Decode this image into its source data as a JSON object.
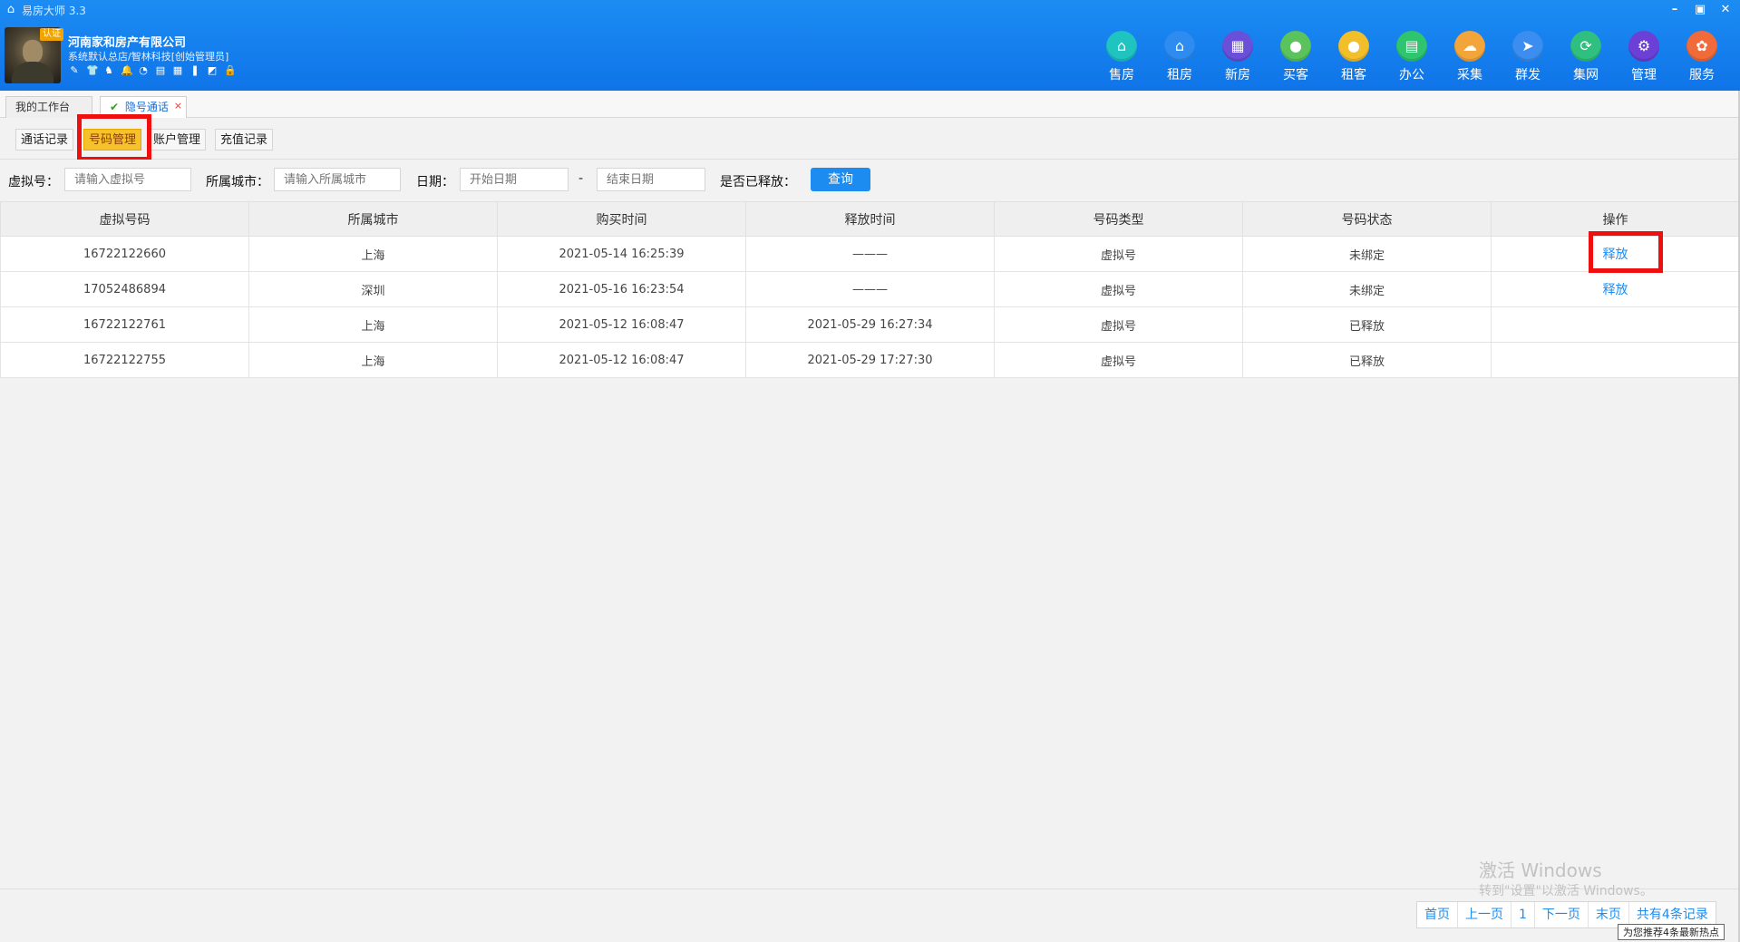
{
  "app": {
    "title": "易房大师 3.3",
    "controls": [
      "–",
      "▣",
      "✕"
    ]
  },
  "profile": {
    "badge": "认证",
    "company": "河南家和房产有限公司",
    "subtitle": "系统默认总店/智林科技[创始管理员]",
    "tool_icons": [
      "✎",
      "👕",
      "♞",
      "🔔",
      "◔",
      "▤",
      "▦",
      "❚",
      "◩",
      "🔒"
    ]
  },
  "nav": [
    {
      "label": "售房",
      "icon": "⌂",
      "color": "#1fc3c0"
    },
    {
      "label": "租房",
      "icon": "⌂",
      "color": "#2e8cf0"
    },
    {
      "label": "新房",
      "icon": "▦",
      "color": "#6a4fd8"
    },
    {
      "label": "买客",
      "icon": "●",
      "color": "#5bc35b"
    },
    {
      "label": "租客",
      "icon": "●",
      "color": "#f2bf2a"
    },
    {
      "label": "办公",
      "icon": "▤",
      "color": "#2fc46e"
    },
    {
      "label": "采集",
      "icon": "☁",
      "color": "#f3a53a"
    },
    {
      "label": "群发",
      "icon": "➤",
      "color": "#3b8ef0"
    },
    {
      "label": "集网",
      "icon": "⟳",
      "color": "#2fbf7e"
    },
    {
      "label": "管理",
      "icon": "⚙",
      "color": "#6c3fd6"
    },
    {
      "label": "服务",
      "icon": "✿",
      "color": "#f06a3a"
    }
  ],
  "tabs": {
    "workbench": "我的工作台",
    "privacy_call": "隐号通话",
    "close": "×"
  },
  "subtabs": [
    "通话记录",
    "号码管理",
    "账户管理",
    "充值记录"
  ],
  "filter": {
    "virtual_label": "虚拟号：",
    "virtual_placeholder": "请输入虚拟号",
    "city_label": "所属城市：",
    "city_placeholder": "请输入所属城市",
    "date_label": "日期：",
    "start_placeholder": "开始日期",
    "dash": "-",
    "end_placeholder": "结束日期",
    "released_label": "是否已释放：",
    "query_button": "查询"
  },
  "table": {
    "headers": [
      "虚拟号码",
      "所属城市",
      "购买时间",
      "释放时间",
      "号码类型",
      "号码状态",
      "操作"
    ],
    "rows": [
      [
        "16722122660",
        "上海",
        "2021-05-14 16:25:39",
        "———",
        "虚拟号",
        "未绑定",
        "释放"
      ],
      [
        "17052486894",
        "深圳",
        "2021-05-16 16:23:54",
        "———",
        "虚拟号",
        "未绑定",
        "释放"
      ],
      [
        "16722122761",
        "上海",
        "2021-05-12 16:08:47",
        "2021-05-29 16:27:34",
        "虚拟号",
        "已释放",
        ""
      ],
      [
        "16722122755",
        "上海",
        "2021-05-12 16:08:47",
        "2021-05-29 17:27:30",
        "虚拟号",
        "已释放",
        ""
      ]
    ]
  },
  "watermark": {
    "line1": "激活 Windows",
    "line2": "转到\"设置\"以激活 Windows。"
  },
  "pager": {
    "first": "首页",
    "prev": "上一页",
    "page": "1",
    "next": "下一页",
    "last": "末页",
    "total": "共有4条记录"
  },
  "tooltip": "为您推荐4条最新热点"
}
